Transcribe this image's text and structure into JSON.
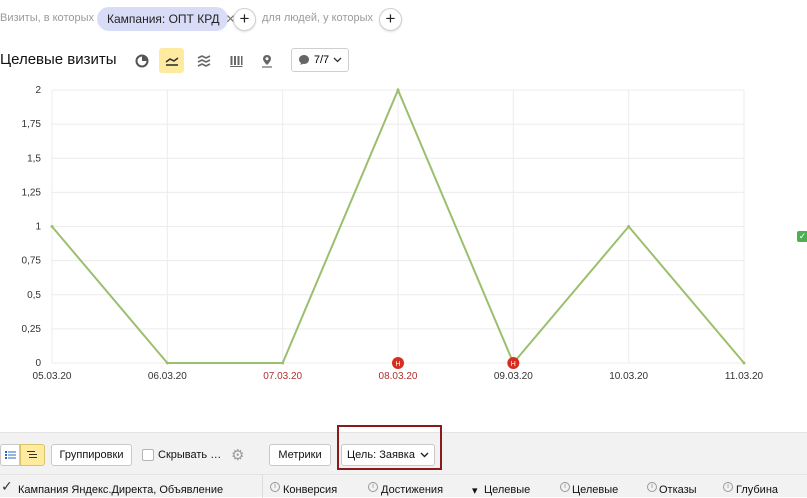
{
  "filters": {
    "visits_label": "Визиты, в которых",
    "campaign_chip": "Кампания: ОПТ КРД",
    "people_label": "для людей, у которых"
  },
  "chart_header": {
    "title": "Целевые визиты",
    "goals_count": "7/7"
  },
  "chart_data": {
    "type": "line",
    "x": [
      "05.03.20",
      "06.03.20",
      "07.03.20",
      "08.03.20",
      "09.03.20",
      "10.03.20",
      "11.03.20"
    ],
    "weekend": [
      "07.03.20",
      "08.03.20"
    ],
    "values": [
      1,
      0,
      0,
      2,
      0,
      1,
      0
    ],
    "ylim": [
      0,
      2
    ],
    "yticks": [
      "0",
      "0,25",
      "0,5",
      "0,75",
      "1",
      "1,25",
      "1,5",
      "1,75",
      "2"
    ],
    "annotations": [
      {
        "x": "08.03.20",
        "label": "Н"
      },
      {
        "x": "09.03.20",
        "label": "Н"
      }
    ],
    "line_color": "#9cbf6e",
    "marker_color": "#d62d20",
    "grid": true
  },
  "toolbar": {
    "grouping": "Группировки",
    "hide_label": "Скрывать ст...",
    "metrics": "Метрики",
    "goal": "Цель: Заявка"
  },
  "table_header": {
    "dimension": "Кампания Яндекс.Директа, Объявление",
    "columns": [
      "Конверсия",
      "Достижения",
      "Целевые",
      "Целевые",
      "Отказы",
      "Глубина"
    ]
  }
}
